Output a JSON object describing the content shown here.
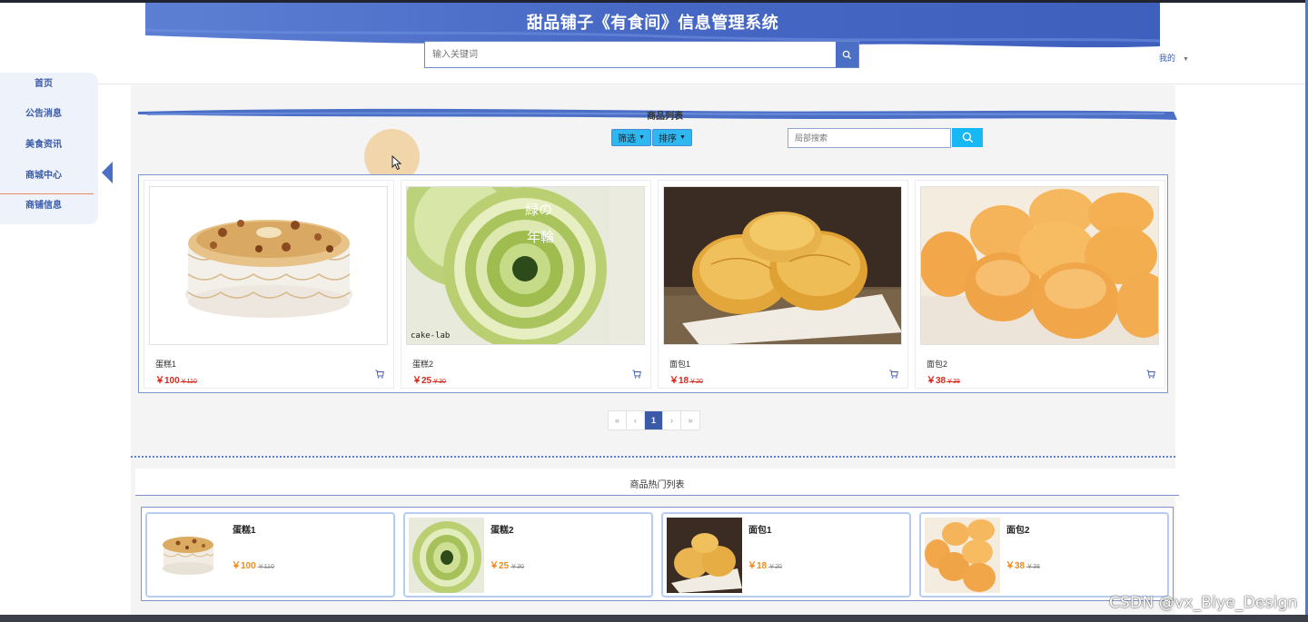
{
  "header": {
    "title": "甜品铺子《有食间》信息管理系统",
    "search_placeholder": "输入关键词",
    "user_menu": "我的"
  },
  "sidebar": {
    "items": [
      {
        "label": "首页"
      },
      {
        "label": "公告消息"
      },
      {
        "label": "美食资讯"
      },
      {
        "label": "商城中心"
      },
      {
        "label": "商铺信息"
      }
    ]
  },
  "products_section": {
    "title": "商品列表",
    "filter_label": "筛选",
    "sort_label": "排序",
    "local_search_placeholder": "局部搜索",
    "products": [
      {
        "name": "蛋糕1",
        "price": "￥100",
        "old_price": "￥110",
        "image": "cake-round"
      },
      {
        "name": "蛋糕2",
        "price": "￥25",
        "old_price": "￥30",
        "image": "matcha-roll"
      },
      {
        "name": "面包1",
        "price": "￥18",
        "old_price": "￥20",
        "image": "pastry-buns"
      },
      {
        "name": "面包2",
        "price": "￥38",
        "old_price": "￥38",
        "image": "bread-rolls"
      }
    ],
    "image_text": "cake-lab",
    "pagination": {
      "first": "«",
      "prev": "‹",
      "current": "1",
      "next": "›",
      "last": "»"
    }
  },
  "hot_section": {
    "title": "商品热门列表",
    "items": [
      {
        "name": "蛋糕1",
        "price": "￥100",
        "old_price": "￥110"
      },
      {
        "name": "蛋糕2",
        "price": "￥25",
        "old_price": "￥30"
      },
      {
        "name": "面包1",
        "price": "￥18",
        "old_price": "￥20"
      },
      {
        "name": "面包2",
        "price": "￥38",
        "old_price": "￥38"
      }
    ]
  },
  "watermark": "CSDN @vx_Biye_Design",
  "colors": {
    "accent": "#4a6fc5",
    "price_red": "#d7281c",
    "hot_price": "#f08a1c",
    "filter_button": "#2fb8f0"
  },
  "icons": [
    "search-icon",
    "cart-icon",
    "caret-down-icon",
    "sidebar-arrow-icon",
    "mouse-cursor-icon"
  ]
}
